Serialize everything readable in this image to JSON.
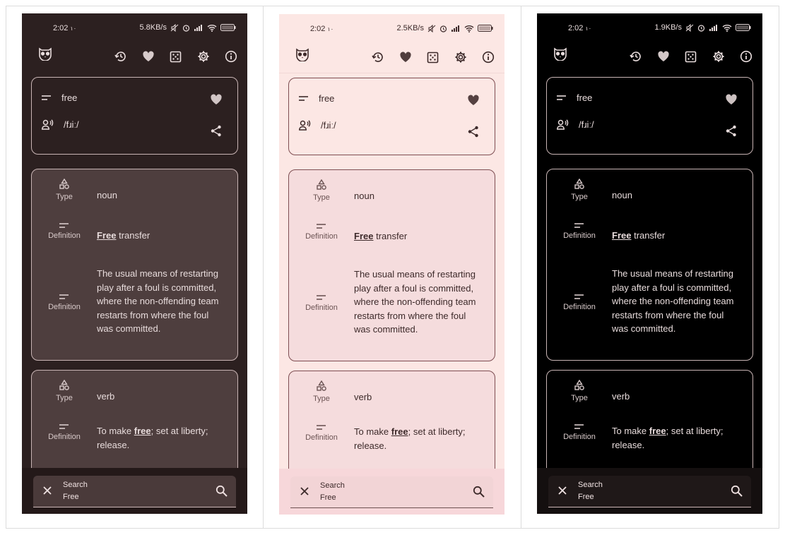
{
  "status": {
    "time": "2:02",
    "time_suffix": "۱۰",
    "battery": "99",
    "speeds": [
      "5.8KB/s",
      "2.5KB/s",
      "1.9KB/s"
    ]
  },
  "icons": {
    "app": "owl-icon",
    "actions": [
      "history-icon",
      "heart-icon",
      "dice-icon",
      "gear-icon",
      "info-icon"
    ],
    "word": "lines-icon",
    "pronunciation": "speaker-person-icon",
    "favorite": "heart-icon",
    "share": "share-icon",
    "type": "shapes-icon",
    "definition": "lines-icon",
    "clear": "close-icon",
    "search": "search-icon"
  },
  "entry": {
    "word": "free",
    "pronunciation": "/fɹiː/"
  },
  "senses": [
    {
      "type_label": "Type",
      "type_value": "noun",
      "definitions": [
        {
          "label": "Definition",
          "bold": "Free",
          "text": " transfer"
        },
        {
          "label": "Definition",
          "bold": "",
          "text": "The usual means of restarting play after a foul is committed, where the non-offending team restarts from where the foul was committed."
        }
      ]
    },
    {
      "type_label": "Type",
      "type_value": "verb",
      "definitions": [
        {
          "label": "Definition",
          "pre": "To make ",
          "bold": "free",
          "text": "; set at liberty; release."
        }
      ]
    }
  ],
  "search": {
    "placeholder": "Search",
    "query": "Free"
  },
  "themes": {
    "dark_brown": {
      "background": "#2c2020",
      "card": "#4e3e3e",
      "outline": "#c9b5b5"
    },
    "light_pink": {
      "background": "#fce7e4",
      "card": "#f5dcdd",
      "outline": "#7e4e52"
    },
    "black": {
      "background": "#000000",
      "card": "#000000",
      "outline": "#c9b5b5"
    }
  }
}
